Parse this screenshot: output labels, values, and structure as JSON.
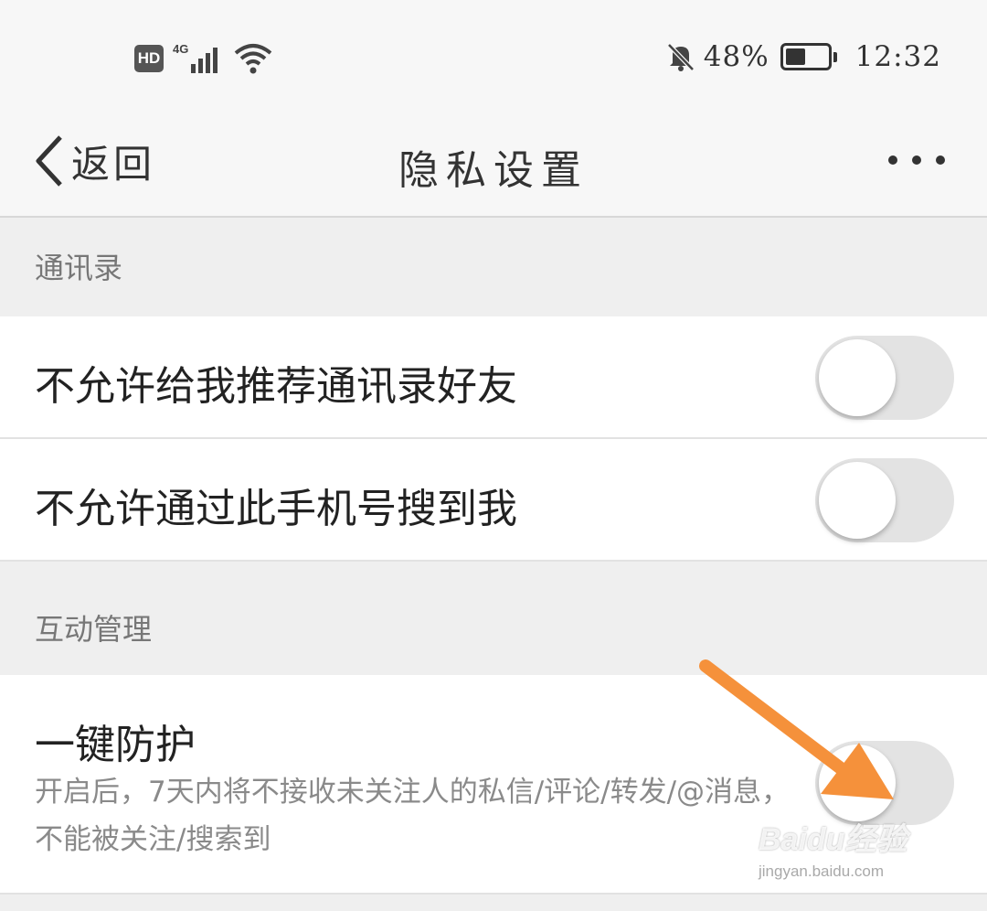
{
  "status_bar": {
    "hd": "HD",
    "network": "4G",
    "battery_text": "48%",
    "battery_level": 0.48,
    "time": "12:32"
  },
  "nav": {
    "back_label": "返回",
    "title": "隐私设置"
  },
  "sections": {
    "contacts": {
      "header": "通讯录",
      "rows": [
        {
          "label": "不允许给我推荐通讯录好友",
          "toggle_on": false
        },
        {
          "label": "不允许通过此手机号搜到我",
          "toggle_on": false
        }
      ]
    },
    "interaction": {
      "header": "互动管理",
      "rows": [
        {
          "label": "一键防护",
          "desc": "开启后，7天内将不接收未关注人的私信/评论/转发/@消息，不能被关注/搜索到",
          "toggle_on": false
        }
      ]
    }
  },
  "annotation": {
    "arrow_color": "#f5913b"
  },
  "watermark": {
    "logo": "Baidu经验",
    "url": "jingyan.baidu.com"
  },
  "icons": [
    "hd-badge",
    "signal-icon",
    "wifi-icon",
    "bell-muted-icon",
    "battery-icon",
    "back-chevron-icon",
    "more-icon"
  ]
}
